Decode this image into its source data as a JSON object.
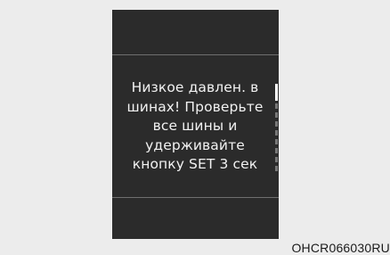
{
  "display": {
    "message_lines": [
      "Низкое давлен. в",
      "шинах! Проверьте",
      "все шины и",
      "удерживайте",
      "кнопку SET 3 сек"
    ]
  },
  "caption": {
    "code": "OHCR066030RU"
  }
}
